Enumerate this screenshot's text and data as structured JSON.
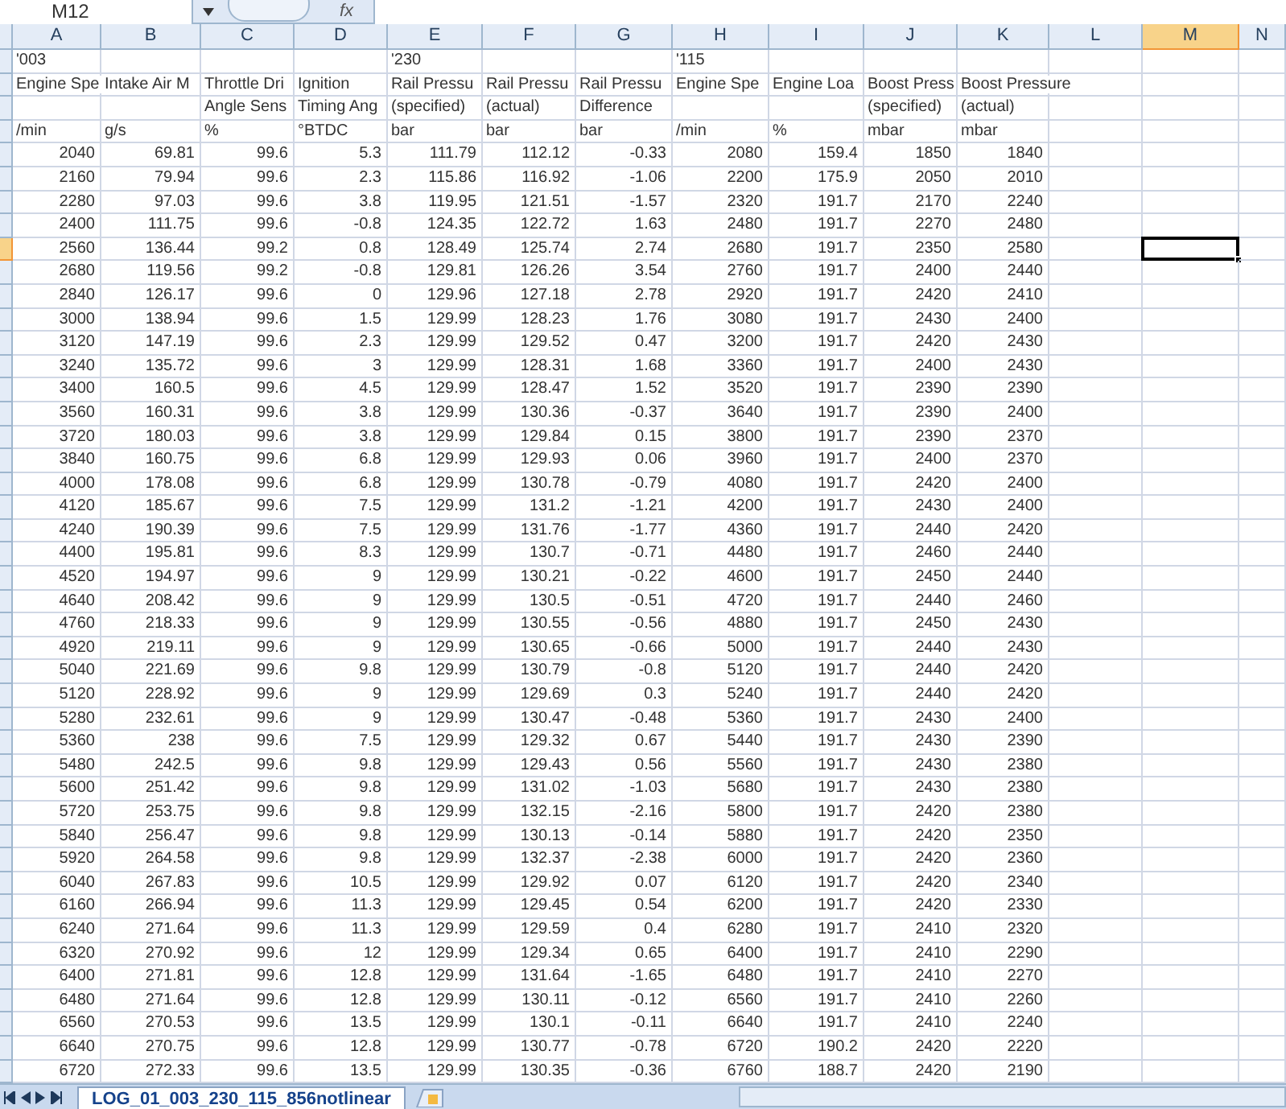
{
  "name_box": "M12",
  "formula_label": "fx",
  "columns": [
    {
      "letter": "A",
      "selected": false
    },
    {
      "letter": "B",
      "selected": false
    },
    {
      "letter": "C",
      "selected": false
    },
    {
      "letter": "D",
      "selected": false
    },
    {
      "letter": "E",
      "selected": false
    },
    {
      "letter": "F",
      "selected": false
    },
    {
      "letter": "G",
      "selected": false
    },
    {
      "letter": "H",
      "selected": false
    },
    {
      "letter": "I",
      "selected": false
    },
    {
      "letter": "J",
      "selected": false
    },
    {
      "letter": "K",
      "selected": false
    },
    {
      "letter": "L",
      "selected": false
    },
    {
      "letter": "M",
      "selected": true
    },
    {
      "letter": "N",
      "selected": false
    }
  ],
  "header_rows": [
    {
      "A": "'003",
      "E": "'230",
      "H": "'115"
    },
    {
      "A": "Engine Spe",
      "B": "Intake Air M",
      "C": "Throttle Dri",
      "D": "Ignition",
      "E": "Rail Pressu",
      "F": "Rail Pressu",
      "G": "Rail Pressu",
      "H": "Engine Spe",
      "I": "Engine Loa",
      "J": "Boost Press",
      "K": "Boost Pressure"
    },
    {
      "C": "Angle Sens",
      "D": "Timing Ang",
      "E": "(specified)",
      "F": "(actual)",
      "G": "Difference",
      "J": "(specified)",
      "K": "(actual)"
    },
    {
      "A": "/min",
      "B": "g/s",
      "C": "%",
      "D": "°BTDC",
      "E": "bar",
      "F": "bar",
      "G": "bar",
      "H": "/min",
      "I": "%",
      "J": "mbar",
      "K": "mbar"
    }
  ],
  "data_rows": [
    {
      "selected": false,
      "cells": [
        "2040",
        "69.81",
        "99.6",
        "5.3",
        "111.79",
        "112.12",
        "-0.33",
        "2080",
        "159.4",
        "1850",
        "1840"
      ]
    },
    {
      "selected": false,
      "cells": [
        "2160",
        "79.94",
        "99.6",
        "2.3",
        "115.86",
        "116.92",
        "-1.06",
        "2200",
        "175.9",
        "2050",
        "2010"
      ]
    },
    {
      "selected": false,
      "cells": [
        "2280",
        "97.03",
        "99.6",
        "3.8",
        "119.95",
        "121.51",
        "-1.57",
        "2320",
        "191.7",
        "2170",
        "2240"
      ]
    },
    {
      "selected": false,
      "cells": [
        "2400",
        "111.75",
        "99.6",
        "-0.8",
        "124.35",
        "122.72",
        "1.63",
        "2480",
        "191.7",
        "2270",
        "2480"
      ]
    },
    {
      "selected": true,
      "cells": [
        "2560",
        "136.44",
        "99.2",
        "0.8",
        "128.49",
        "125.74",
        "2.74",
        "2680",
        "191.7",
        "2350",
        "2580"
      ]
    },
    {
      "selected": false,
      "cells": [
        "2680",
        "119.56",
        "99.2",
        "-0.8",
        "129.81",
        "126.26",
        "3.54",
        "2760",
        "191.7",
        "2400",
        "2440"
      ]
    },
    {
      "selected": false,
      "cells": [
        "2840",
        "126.17",
        "99.6",
        "0",
        "129.96",
        "127.18",
        "2.78",
        "2920",
        "191.7",
        "2420",
        "2410"
      ]
    },
    {
      "selected": false,
      "cells": [
        "3000",
        "138.94",
        "99.6",
        "1.5",
        "129.99",
        "128.23",
        "1.76",
        "3080",
        "191.7",
        "2430",
        "2400"
      ]
    },
    {
      "selected": false,
      "cells": [
        "3120",
        "147.19",
        "99.6",
        "2.3",
        "129.99",
        "129.52",
        "0.47",
        "3200",
        "191.7",
        "2420",
        "2430"
      ]
    },
    {
      "selected": false,
      "cells": [
        "3240",
        "135.72",
        "99.6",
        "3",
        "129.99",
        "128.31",
        "1.68",
        "3360",
        "191.7",
        "2400",
        "2430"
      ]
    },
    {
      "selected": false,
      "cells": [
        "3400",
        "160.5",
        "99.6",
        "4.5",
        "129.99",
        "128.47",
        "1.52",
        "3520",
        "191.7",
        "2390",
        "2390"
      ]
    },
    {
      "selected": false,
      "cells": [
        "3560",
        "160.31",
        "99.6",
        "3.8",
        "129.99",
        "130.36",
        "-0.37",
        "3640",
        "191.7",
        "2390",
        "2400"
      ]
    },
    {
      "selected": false,
      "cells": [
        "3720",
        "180.03",
        "99.6",
        "3.8",
        "129.99",
        "129.84",
        "0.15",
        "3800",
        "191.7",
        "2390",
        "2370"
      ]
    },
    {
      "selected": false,
      "cells": [
        "3840",
        "160.75",
        "99.6",
        "6.8",
        "129.99",
        "129.93",
        "0.06",
        "3960",
        "191.7",
        "2400",
        "2370"
      ]
    },
    {
      "selected": false,
      "cells": [
        "4000",
        "178.08",
        "99.6",
        "6.8",
        "129.99",
        "130.78",
        "-0.79",
        "4080",
        "191.7",
        "2420",
        "2400"
      ]
    },
    {
      "selected": false,
      "cells": [
        "4120",
        "185.67",
        "99.6",
        "7.5",
        "129.99",
        "131.2",
        "-1.21",
        "4200",
        "191.7",
        "2430",
        "2400"
      ]
    },
    {
      "selected": false,
      "cells": [
        "4240",
        "190.39",
        "99.6",
        "7.5",
        "129.99",
        "131.76",
        "-1.77",
        "4360",
        "191.7",
        "2440",
        "2420"
      ]
    },
    {
      "selected": false,
      "cells": [
        "4400",
        "195.81",
        "99.6",
        "8.3",
        "129.99",
        "130.7",
        "-0.71",
        "4480",
        "191.7",
        "2460",
        "2440"
      ]
    },
    {
      "selected": false,
      "cells": [
        "4520",
        "194.97",
        "99.6",
        "9",
        "129.99",
        "130.21",
        "-0.22",
        "4600",
        "191.7",
        "2450",
        "2440"
      ]
    },
    {
      "selected": false,
      "cells": [
        "4640",
        "208.42",
        "99.6",
        "9",
        "129.99",
        "130.5",
        "-0.51",
        "4720",
        "191.7",
        "2440",
        "2460"
      ]
    },
    {
      "selected": false,
      "cells": [
        "4760",
        "218.33",
        "99.6",
        "9",
        "129.99",
        "130.55",
        "-0.56",
        "4880",
        "191.7",
        "2450",
        "2430"
      ]
    },
    {
      "selected": false,
      "cells": [
        "4920",
        "219.11",
        "99.6",
        "9",
        "129.99",
        "130.65",
        "-0.66",
        "5000",
        "191.7",
        "2440",
        "2430"
      ]
    },
    {
      "selected": false,
      "cells": [
        "5040",
        "221.69",
        "99.6",
        "9.8",
        "129.99",
        "130.79",
        "-0.8",
        "5120",
        "191.7",
        "2440",
        "2420"
      ]
    },
    {
      "selected": false,
      "cells": [
        "5120",
        "228.92",
        "99.6",
        "9",
        "129.99",
        "129.69",
        "0.3",
        "5240",
        "191.7",
        "2440",
        "2420"
      ]
    },
    {
      "selected": false,
      "cells": [
        "5280",
        "232.61",
        "99.6",
        "9",
        "129.99",
        "130.47",
        "-0.48",
        "5360",
        "191.7",
        "2430",
        "2400"
      ]
    },
    {
      "selected": false,
      "cells": [
        "5360",
        "238",
        "99.6",
        "7.5",
        "129.99",
        "129.32",
        "0.67",
        "5440",
        "191.7",
        "2430",
        "2390"
      ]
    },
    {
      "selected": false,
      "cells": [
        "5480",
        "242.5",
        "99.6",
        "9.8",
        "129.99",
        "129.43",
        "0.56",
        "5560",
        "191.7",
        "2430",
        "2380"
      ]
    },
    {
      "selected": false,
      "cells": [
        "5600",
        "251.42",
        "99.6",
        "9.8",
        "129.99",
        "131.02",
        "-1.03",
        "5680",
        "191.7",
        "2430",
        "2380"
      ]
    },
    {
      "selected": false,
      "cells": [
        "5720",
        "253.75",
        "99.6",
        "9.8",
        "129.99",
        "132.15",
        "-2.16",
        "5800",
        "191.7",
        "2420",
        "2380"
      ]
    },
    {
      "selected": false,
      "cells": [
        "5840",
        "256.47",
        "99.6",
        "9.8",
        "129.99",
        "130.13",
        "-0.14",
        "5880",
        "191.7",
        "2420",
        "2350"
      ]
    },
    {
      "selected": false,
      "cells": [
        "5920",
        "264.58",
        "99.6",
        "9.8",
        "129.99",
        "132.37",
        "-2.38",
        "6000",
        "191.7",
        "2420",
        "2360"
      ]
    },
    {
      "selected": false,
      "cells": [
        "6040",
        "267.83",
        "99.6",
        "10.5",
        "129.99",
        "129.92",
        "0.07",
        "6120",
        "191.7",
        "2420",
        "2340"
      ]
    },
    {
      "selected": false,
      "cells": [
        "6160",
        "266.94",
        "99.6",
        "11.3",
        "129.99",
        "129.45",
        "0.54",
        "6200",
        "191.7",
        "2420",
        "2330"
      ]
    },
    {
      "selected": false,
      "cells": [
        "6240",
        "271.64",
        "99.6",
        "11.3",
        "129.99",
        "129.59",
        "0.4",
        "6280",
        "191.7",
        "2410",
        "2320"
      ]
    },
    {
      "selected": false,
      "cells": [
        "6320",
        "270.92",
        "99.6",
        "12",
        "129.99",
        "129.34",
        "0.65",
        "6400",
        "191.7",
        "2410",
        "2290"
      ]
    },
    {
      "selected": false,
      "cells": [
        "6400",
        "271.81",
        "99.6",
        "12.8",
        "129.99",
        "131.64",
        "-1.65",
        "6480",
        "191.7",
        "2410",
        "2270"
      ]
    },
    {
      "selected": false,
      "cells": [
        "6480",
        "271.64",
        "99.6",
        "12.8",
        "129.99",
        "130.11",
        "-0.12",
        "6560",
        "191.7",
        "2410",
        "2260"
      ]
    },
    {
      "selected": false,
      "cells": [
        "6560",
        "270.53",
        "99.6",
        "13.5",
        "129.99",
        "130.1",
        "-0.11",
        "6640",
        "191.7",
        "2410",
        "2240"
      ]
    },
    {
      "selected": false,
      "cells": [
        "6640",
        "270.75",
        "99.6",
        "12.8",
        "129.99",
        "130.77",
        "-0.78",
        "6720",
        "190.2",
        "2420",
        "2220"
      ]
    },
    {
      "selected": false,
      "cells": [
        "6720",
        "272.33",
        "99.6",
        "13.5",
        "129.99",
        "130.35",
        "-0.36",
        "6760",
        "188.7",
        "2420",
        "2190"
      ]
    }
  ],
  "sheet_tabs": [
    {
      "label": "LOG_01_003_230_115_856notlinear",
      "selected": true
    }
  ]
}
